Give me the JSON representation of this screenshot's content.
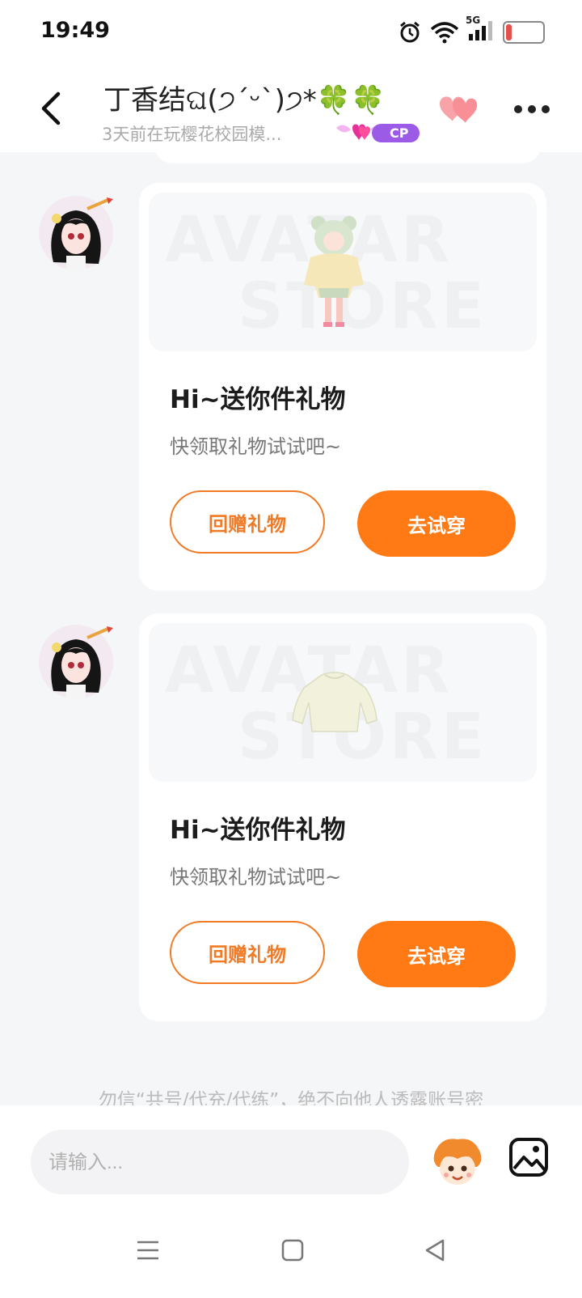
{
  "status_bar": {
    "time": "19:49",
    "battery": "18",
    "battery_level": 0.18,
    "network": "5G"
  },
  "header": {
    "title": "丁香结ଘ(੭ˊᵕˋ)੭*🍀🍀",
    "subtitle": "3天前在玩樱花校园模...",
    "cp_badge": "CP"
  },
  "cards": [
    {
      "title": "Hi~送你件礼物",
      "desc": "快领取礼物试试吧~",
      "gift_button": "回赠礼物",
      "try_button": "去试穿"
    },
    {
      "title": "Hi~送你件礼物",
      "desc": "快领取礼物试试吧~",
      "gift_button": "回赠礼物",
      "try_button": "去试穿"
    }
  ],
  "notice": "勿信“共号/代充/代练”，绝不向他人透露账号密",
  "input": {
    "placeholder": "请输入..."
  },
  "colors": {
    "accent": "#ff7a14",
    "outline": "#f07a25",
    "cp": "#9c5be6"
  }
}
